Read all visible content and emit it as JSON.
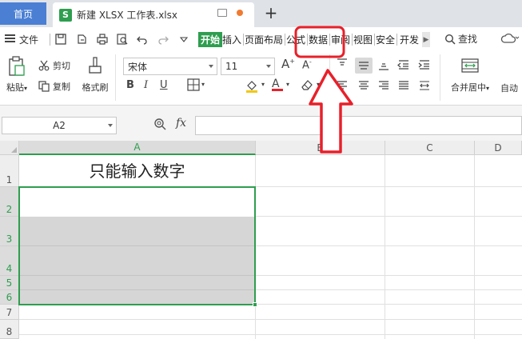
{
  "titlebar": {
    "home_tab": "首页",
    "doc_icon_letter": "S",
    "doc_title": "新建 XLSX 工作表.xlsx",
    "new_tab": "+"
  },
  "menubar": {
    "file": "文件",
    "tabs": [
      "开始",
      "插入",
      "页面布局",
      "公式",
      "数据",
      "审阅",
      "视图",
      "安全",
      "开发"
    ],
    "active_tab": "开始",
    "search": "查找"
  },
  "ribbon": {
    "paste": "粘贴",
    "cut": "剪切",
    "copy": "复制",
    "format_painter": "格式刷",
    "font_name": "宋体",
    "font_size": "11",
    "merge_center": "合并居中",
    "auto_wrap": "自动"
  },
  "formula_bar": {
    "name_box": "A2",
    "fx": "fx",
    "formula": ""
  },
  "sheet": {
    "columns": [
      "A",
      "B",
      "C",
      "D"
    ],
    "rows": [
      "1",
      "2",
      "3",
      "4",
      "5",
      "6",
      "7",
      "8"
    ],
    "cell_a1": "只能输入数字"
  },
  "annotation": {
    "highlight_tab": "数据",
    "color": "#e8202a"
  },
  "colors": {
    "accent": "#2e9e4f",
    "home_tab": "#4a7fd4",
    "annotation": "#e8202a"
  }
}
